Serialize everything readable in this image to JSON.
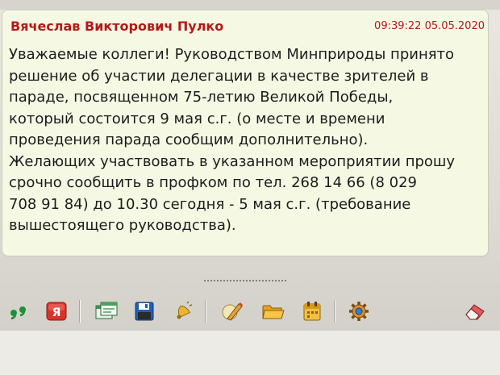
{
  "message": {
    "sender": "Вячеслав Викторович Пулко",
    "timestamp": "09:39:22 05.05.2020",
    "body_lines": [
      "Уважаемые коллеги! Руководством Минприроды принято",
      "решение об участии делегации  в качестве зрителей в",
      "параде, посвященном 75-летию Великой Победы,",
      "который состоится 9 мая с.г. (о месте и времени",
      "проведения парада сообщим дополнительно).",
      "Желающих участвовать в указанном мероприятии прошу",
      "срочно сообщить в профком по тел. 268 14 66 (8 029",
      "708 91 84) до 10.30 сегодня - 5 мая с.г. (требование",
      "вышестоящего руководства)."
    ]
  },
  "colors": {
    "sender_text": "#b31919",
    "message_background": "#f5f9e4",
    "body_text": "#1c1c1c"
  },
  "toolbar": {
    "buttons": [
      {
        "name": "quote-button",
        "icon": "quote-icon"
      },
      {
        "name": "translit-button",
        "icon": "letter-ya-icon"
      },
      {
        "name": "screenshot-button",
        "icon": "windows-icon"
      },
      {
        "name": "save-button",
        "icon": "floppy-disk-icon"
      },
      {
        "name": "alert-button",
        "icon": "bell-icon"
      },
      {
        "name": "smileys-button",
        "icon": "pencil-icon"
      },
      {
        "name": "send-file-button",
        "icon": "folder-icon"
      },
      {
        "name": "calendar-button",
        "icon": "calendar-icon"
      },
      {
        "name": "settings-button",
        "icon": "gear-icon"
      },
      {
        "name": "clear-button",
        "icon": "eraser-icon"
      }
    ]
  }
}
